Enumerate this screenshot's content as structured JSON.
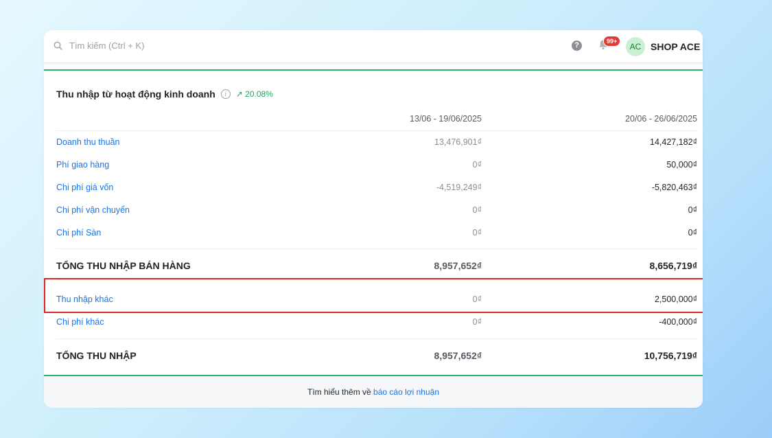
{
  "search": {
    "placeholder": "Tìm kiếm (Ctrl + K)"
  },
  "header": {
    "notification_count": "99+",
    "avatar_initials": "AC",
    "shop_name": "SHOP ACE",
    "help_icon": "help-circle-icon",
    "bell_icon": "bell-icon"
  },
  "report": {
    "title": "Thu nhập từ hoạt động kinh doanh",
    "trend": "↗ 20.08%",
    "trend_color": "#1fa85a",
    "period_1": "13/06 - 19/06/2025",
    "period_2": "20/06 - 26/06/2025",
    "rows": [
      {
        "label": "Doanh thu thuần",
        "v1": "13,476,901₫",
        "v2": "14,427,182₫"
      },
      {
        "label": "Phí giao hàng",
        "v1": "0₫",
        "v2": "50,000₫"
      },
      {
        "label": "Chi phí giá vốn",
        "v1": "-4,519,249₫",
        "v2": "-5,820,463₫"
      },
      {
        "label": "Chi phí vận chuyển",
        "v1": "0₫",
        "v2": "0₫"
      },
      {
        "label": "Chi phí Sàn",
        "v1": "0₫",
        "v2": "0₫"
      }
    ],
    "sales_total": {
      "label": "TỔNG THU NHẬP BÁN HÀNG",
      "v1": "8,957,652₫",
      "v2": "8,656,719₫"
    },
    "other_rows": [
      {
        "label": "Thu nhập khác",
        "v1": "0₫",
        "v2": "2,500,000₫"
      },
      {
        "label": "Chi phí khác",
        "v1": "0₫",
        "v2": "-400,000₫"
      }
    ],
    "grand_total": {
      "label": "TỔNG THU NHẬP",
      "v1": "8,957,652₫",
      "v2": "10,756,719₫"
    }
  },
  "footer": {
    "text": "Tìm hiểu thêm về",
    "link": "báo cáo lợi nhuận"
  },
  "colors": {
    "accent": "#1a73e8",
    "green": "#2fb36b",
    "highlight": "#e02424"
  }
}
